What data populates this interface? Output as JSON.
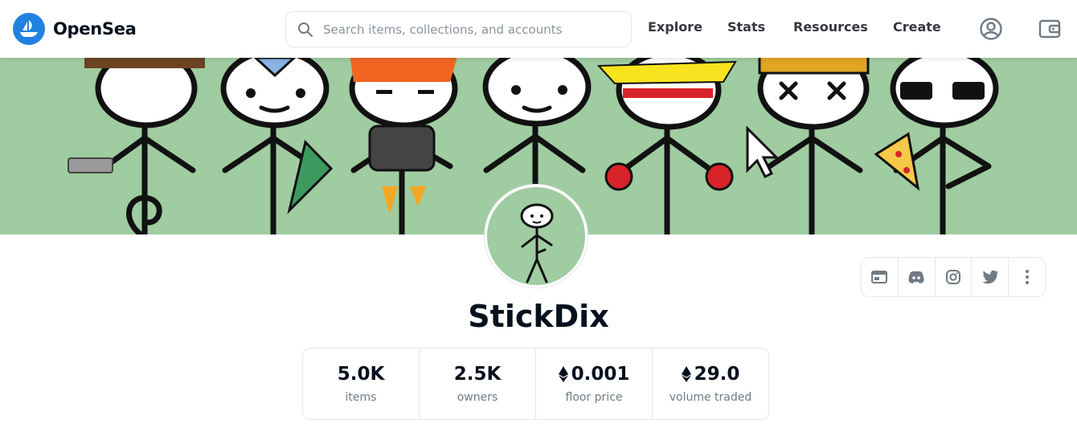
{
  "header": {
    "brand": "OpenSea",
    "search_placeholder": "Search items, collections, and accounts",
    "nav": [
      "Explore",
      "Stats",
      "Resources",
      "Create"
    ]
  },
  "collection": {
    "name": "StickDix"
  },
  "stats": [
    {
      "value": "5.0K",
      "label": "items",
      "eth": false
    },
    {
      "value": "2.5K",
      "label": "owners",
      "eth": false
    },
    {
      "value": "0.001",
      "label": "floor price",
      "eth": true
    },
    {
      "value": "29.0",
      "label": "volume traded",
      "eth": true
    }
  ],
  "socials": [
    "website-icon",
    "discord-icon",
    "instagram-icon",
    "twitter-icon",
    "more-icon"
  ],
  "colors": {
    "brand_blue": "#2081e2",
    "banner_green": "#9fcca0",
    "text_dark": "#04111d",
    "text_muted": "#707a83",
    "border": "#e5e8eb"
  }
}
